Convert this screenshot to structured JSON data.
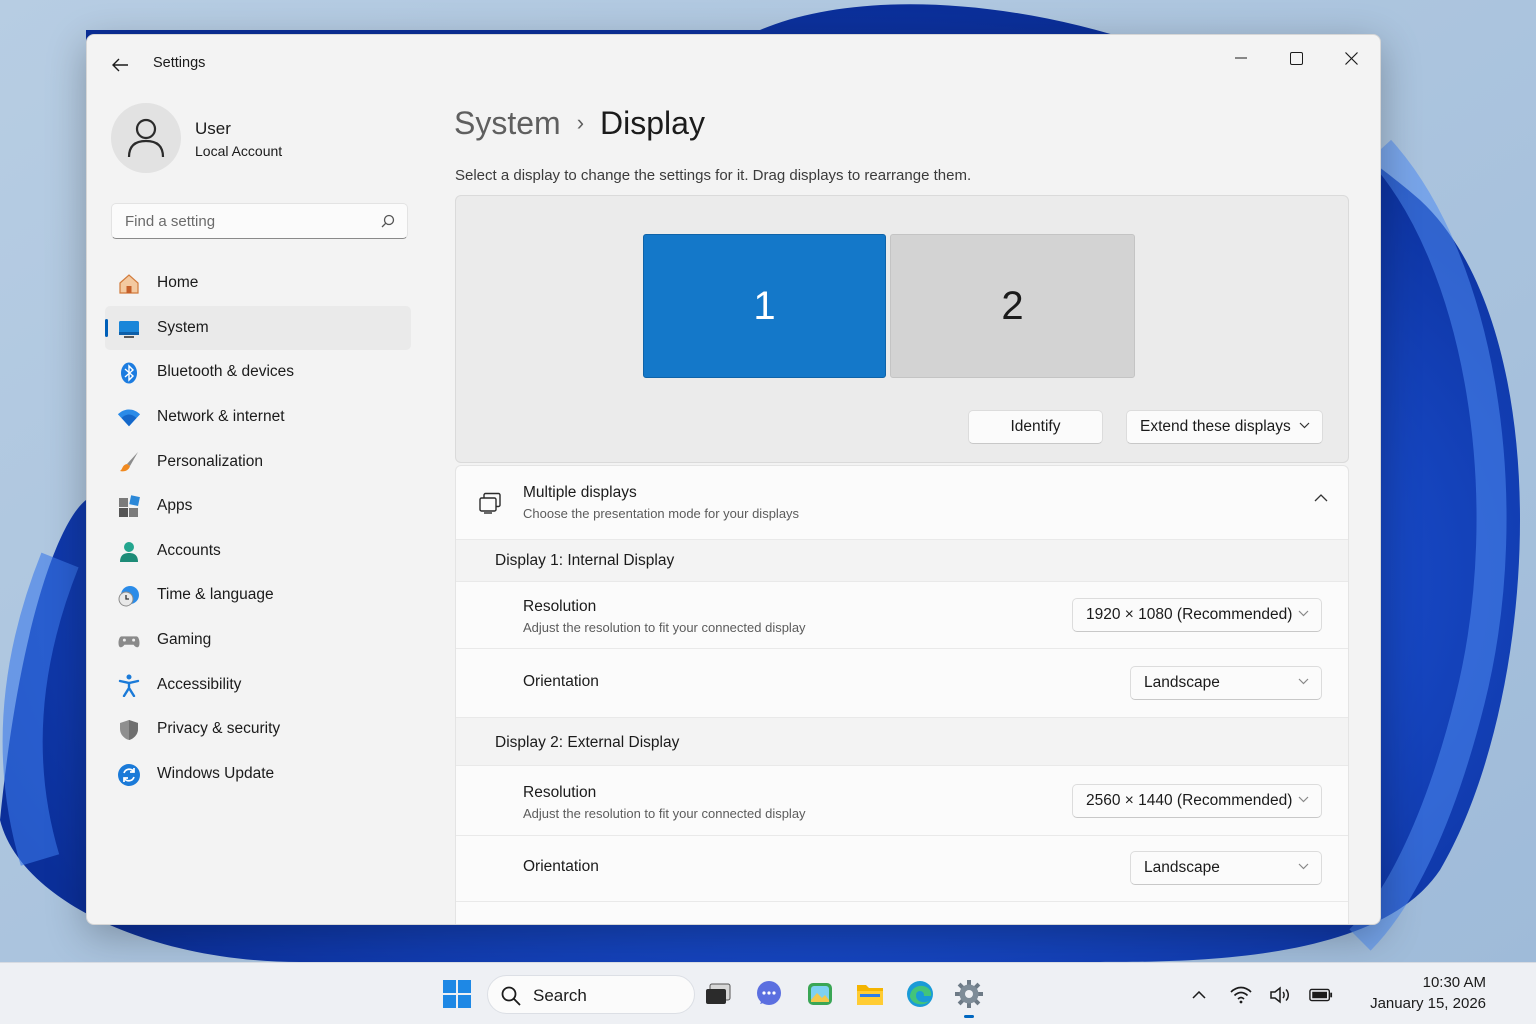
{
  "window": {
    "app_title": "Settings"
  },
  "profile": {
    "name": "User",
    "account_type": "Local Account"
  },
  "search": {
    "placeholder": "Find a setting"
  },
  "sidebar": {
    "items": [
      {
        "label": "Home",
        "icon": "home-icon"
      },
      {
        "label": "System",
        "icon": "system-icon",
        "active": true
      },
      {
        "label": "Bluetooth & devices",
        "icon": "bluetooth-icon"
      },
      {
        "label": "Network & internet",
        "icon": "wifi-icon"
      },
      {
        "label": "Personalization",
        "icon": "brush-icon"
      },
      {
        "label": "Apps",
        "icon": "apps-icon"
      },
      {
        "label": "Accounts",
        "icon": "person-icon"
      },
      {
        "label": "Time & language",
        "icon": "clock-globe-icon"
      },
      {
        "label": "Gaming",
        "icon": "controller-icon"
      },
      {
        "label": "Accessibility",
        "icon": "accessibility-icon"
      },
      {
        "label": "Privacy & security",
        "icon": "shield-icon"
      },
      {
        "label": "Windows Update",
        "icon": "update-icon"
      }
    ]
  },
  "breadcrumb": {
    "parent": "System",
    "separator": "›",
    "current": "Display"
  },
  "main": {
    "instruction": "Select a display to change the settings for it. Drag displays to rearrange them.",
    "monitors": [
      {
        "label": "1",
        "selected": true,
        "color": "#1478c9"
      },
      {
        "label": "2",
        "selected": false,
        "color": "#d3d3d3"
      }
    ],
    "identify_label": "Identify",
    "display_mode": "Extend these displays",
    "multiple_displays": {
      "title": "Multiple displays",
      "subtitle": "Choose the presentation mode for your displays"
    },
    "sections": [
      {
        "heading": "Display 1: Internal Display",
        "resolution_title": "Resolution",
        "resolution_subtitle": "Adjust the resolution to fit your connected display",
        "resolution_value": "1920 × 1080 (Recommended)",
        "orientation_title": "Orientation",
        "orientation_value": "Landscape"
      },
      {
        "heading": "Display 2: External Display",
        "resolution_title": "Resolution",
        "resolution_subtitle": "Adjust the resolution to fit your connected display",
        "resolution_value": "2560 × 1440 (Recommended)",
        "orientation_title": "Orientation",
        "orientation_value": "Landscape"
      }
    ]
  },
  "taskbar": {
    "search_label": "Search",
    "apps": [
      "start-icon",
      "task-view-icon",
      "chat-icon",
      "photos-icon",
      "file-explorer-icon",
      "edge-icon",
      "settings-gear-icon"
    ],
    "clock": {
      "time": "10:30 AM",
      "date": "January 15, 2026"
    }
  },
  "colors": {
    "accent": "#005fb8",
    "selected_monitor": "#1478c9"
  }
}
